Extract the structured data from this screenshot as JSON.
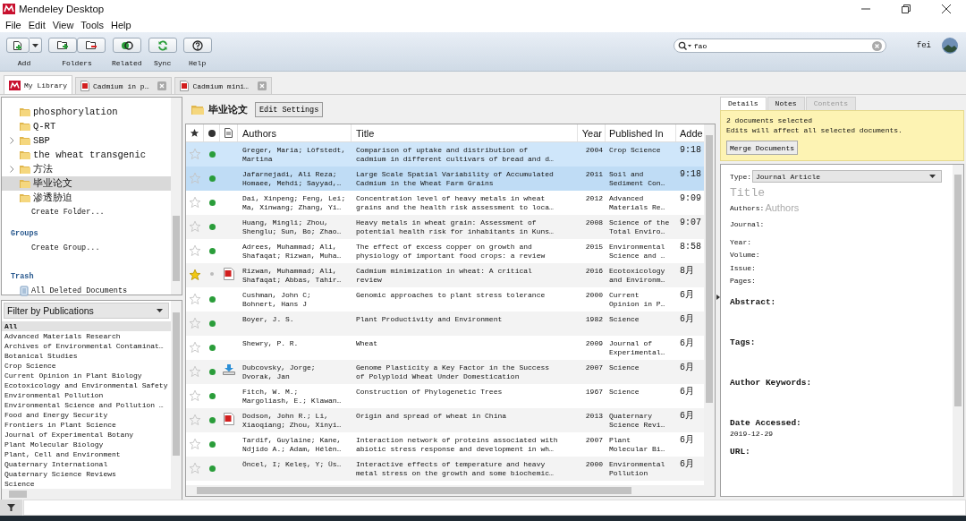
{
  "window": {
    "title": "Mendeley Desktop"
  },
  "menu": [
    "File",
    "Edit",
    "View",
    "Tools",
    "Help"
  ],
  "toolbar": [
    {
      "label": "Add",
      "kind": "add"
    },
    {
      "label": "Folders",
      "kind": "folders"
    },
    {
      "label": "Related",
      "kind": "related"
    },
    {
      "label": "Sync",
      "kind": "sync"
    },
    {
      "label": "Help",
      "kind": "help"
    }
  ],
  "search": {
    "value": "fao"
  },
  "user": {
    "name": "fei"
  },
  "tabs": [
    {
      "label": "My Library",
      "kind": "library",
      "selected": true
    },
    {
      "label": "Cadmium in p…",
      "kind": "pdf",
      "selected": false
    },
    {
      "label": "Cadmium mini…",
      "kind": "pdf",
      "selected": false
    }
  ],
  "sidebar": {
    "folders": [
      {
        "label": "phosphorylation",
        "expandable": false,
        "selected": false
      },
      {
        "label": "Q-RT",
        "expandable": false,
        "selected": false
      },
      {
        "label": "SBP",
        "expandable": true,
        "selected": false
      },
      {
        "label": "the wheat transgenic",
        "expandable": false,
        "selected": false
      },
      {
        "label": "方法",
        "expandable": true,
        "selected": false
      },
      {
        "label": "毕业论文",
        "expandable": false,
        "selected": true
      },
      {
        "label": "渗透胁迫",
        "expandable": false,
        "selected": false
      }
    ],
    "create_folder": "Create Folder...",
    "groups": {
      "heading": "Groups",
      "action": "Create Group..."
    },
    "trash": {
      "heading": "Trash",
      "item": "All Deleted Documents"
    }
  },
  "filter": {
    "title": "Filter by Publications",
    "items": [
      {
        "label": "All",
        "selected": true
      },
      {
        "label": "Advanced Materials Research",
        "selected": false
      },
      {
        "label": "Archives of Environmental Contaminat…",
        "selected": false
      },
      {
        "label": "Botanical Studies",
        "selected": false
      },
      {
        "label": "Crop Science",
        "selected": false
      },
      {
        "label": "Current Opinion in Plant Biology",
        "selected": false
      },
      {
        "label": "Ecotoxicology and Environmental Safety",
        "selected": false
      },
      {
        "label": "Environmental Pollution",
        "selected": false
      },
      {
        "label": "Environmental Science and Pollution …",
        "selected": false
      },
      {
        "label": "Food and Energy Security",
        "selected": false
      },
      {
        "label": "Frontiers in Plant Science",
        "selected": false
      },
      {
        "label": "Journal of Experimental Botany",
        "selected": false
      },
      {
        "label": "Plant Molecular Biology",
        "selected": false
      },
      {
        "label": "Plant, Cell and Environment",
        "selected": false
      },
      {
        "label": "Quaternary International",
        "selected": false
      },
      {
        "label": "Quaternary Science Reviews",
        "selected": false
      },
      {
        "label": "Science",
        "selected": false
      }
    ]
  },
  "folder": {
    "name": "毕业论文",
    "button": "Edit Settings"
  },
  "table": {
    "columns": [
      "Authors",
      "Title",
      "Year",
      "Published In",
      "Adde"
    ],
    "rows": [
      {
        "selected": true,
        "starred": false,
        "unread": true,
        "kind": "plain",
        "authors": "Greger, Maria; Löfstedt, Martina",
        "title": "Comparison of uptake and distribution of cadmium in different cultivars of bread and d…",
        "year": "2004",
        "published_in": "Crop Science",
        "added": "9:18"
      },
      {
        "selected": true,
        "starred": false,
        "unread": true,
        "kind": "plain",
        "authors": "Jafarnejadi, Ali Reza; Homaee, Mehdi; Sayyad,…",
        "title": "Large Scale Spatial Variability of Accumulated Cadmium in the Wheat Farm Grains",
        "year": "2011",
        "published_in": "Soil and Sediment Con…",
        "added": "9:18"
      },
      {
        "selected": false,
        "starred": false,
        "unread": true,
        "kind": "plain",
        "authors": "Dai, Xinpeng; Feng, Lei; Ma, Xinwang; Zhang, Yi…",
        "title": "Concentration level of heavy metals in wheat grains and the health risk assessment to loca…",
        "year": "2012",
        "published_in": "Advanced Materials Re…",
        "added": "9:09"
      },
      {
        "selected": false,
        "starred": false,
        "unread": true,
        "kind": "plain",
        "authors": "Huang, Mingli; Zhou, Shenglu; Sun, Bo; Zhao…",
        "title": "Heavy metals in wheat grain: Assessment of potential health risk for inhabitants in Kuns…",
        "year": "2008",
        "published_in": "Science of the Total Enviro…",
        "added": "9:07"
      },
      {
        "selected": false,
        "starred": false,
        "unread": true,
        "kind": "plain",
        "authors": "Adrees, Muhammad; Ali, Shafaqat; Rizwan, Muha…",
        "title": "The effect of excess copper on growth and physiology of important food crops: a review",
        "year": "2015",
        "published_in": "Environmental Science and …",
        "added": "8:58"
      },
      {
        "selected": false,
        "starred": true,
        "unread": false,
        "kind": "pdf",
        "authors": "Rizwan, Muhammad; Ali, Shafaqat; Abbas, Tahir…",
        "title": "Cadmium minimization in wheat: A critical review",
        "year": "2016",
        "published_in": "Ecotoxicology and Environm…",
        "added": "8月"
      },
      {
        "selected": false,
        "starred": false,
        "unread": true,
        "kind": "plain",
        "authors": "Cushman, John C; Bohnert, Hans J",
        "title": "Genomic approaches to plant stress tolerance",
        "year": "2000",
        "published_in": "Current Opinion in P…",
        "added": "6月"
      },
      {
        "selected": false,
        "starred": false,
        "unread": true,
        "kind": "plain",
        "authors": "Boyer, J. S.",
        "title": "Plant Productivity and Environment",
        "year": "1982",
        "published_in": "Science",
        "added": "6月"
      },
      {
        "selected": false,
        "starred": false,
        "unread": true,
        "kind": "plain",
        "authors": "Shewry, P. R.",
        "title": "Wheat",
        "year": "2009",
        "published_in": "Journal of Experimental…",
        "added": "6月"
      },
      {
        "selected": false,
        "starred": false,
        "unread": true,
        "kind": "download",
        "authors": "Dubcovsky, Jorge; Dvorak, Jan",
        "title": "Genome Plasticity a Key Factor in the Success of Polyploid Wheat Under Domestication",
        "year": "2007",
        "published_in": "Science",
        "added": "6月"
      },
      {
        "selected": false,
        "starred": false,
        "unread": true,
        "kind": "plain",
        "authors": "Fitch, W. M.; Margoliash, E.; Klawan…",
        "title": "Construction of Phylogenetic Trees",
        "year": "1967",
        "published_in": "Science",
        "added": "6月"
      },
      {
        "selected": false,
        "starred": false,
        "unread": true,
        "kind": "pdf",
        "authors": "Dodson, John R.; Li, Xiaoqiang; Zhou, Xinyi…",
        "title": "Origin and spread of wheat in China",
        "year": "2013",
        "published_in": "Quaternary Science Revi…",
        "added": "6月"
      },
      {
        "selected": false,
        "starred": false,
        "unread": true,
        "kind": "plain",
        "authors": "Tardif, Guylaine; Kane, Ndjido A.; Adam, Hélèn…",
        "title": "Interaction network of proteins associated with abiotic stress response and development in wh…",
        "year": "2007",
        "published_in": "Plant Molecular Bi…",
        "added": "6月"
      },
      {
        "selected": false,
        "starred": false,
        "unread": true,
        "kind": "plain",
        "authors": "Öncel, I; Keleş, Y; Üs…",
        "title": "Interactive effects of temperature and heavy metal stress on the growth and some biochemic…",
        "year": "2000",
        "published_in": "Environmental Pollution",
        "added": "6月"
      }
    ]
  },
  "details": {
    "tabs": [
      {
        "label": "Details",
        "selected": true,
        "disabled": false
      },
      {
        "label": "Notes",
        "selected": false,
        "disabled": false
      },
      {
        "label": "Contents",
        "selected": false,
        "disabled": true
      }
    ],
    "notice": [
      "2 documents selected",
      "Edits will affect all selected documents."
    ],
    "merge_button": "Merge Documents",
    "type": {
      "label": "Type:",
      "value": "Journal Article"
    },
    "title": {
      "placeholder": "Title"
    },
    "authors": {
      "label": "Authors:",
      "placeholder": "Authors"
    },
    "fields": [
      "Journal:",
      "Year:",
      "Volume:",
      "Issue:",
      "Pages:"
    ],
    "sections": [
      {
        "heading": "Abstract:"
      },
      {
        "heading": "Tags:"
      },
      {
        "heading": "Author Keywords:"
      },
      {
        "heading": "Date Accessed:",
        "value": "2019-12-29"
      },
      {
        "heading": "URL:"
      }
    ]
  }
}
